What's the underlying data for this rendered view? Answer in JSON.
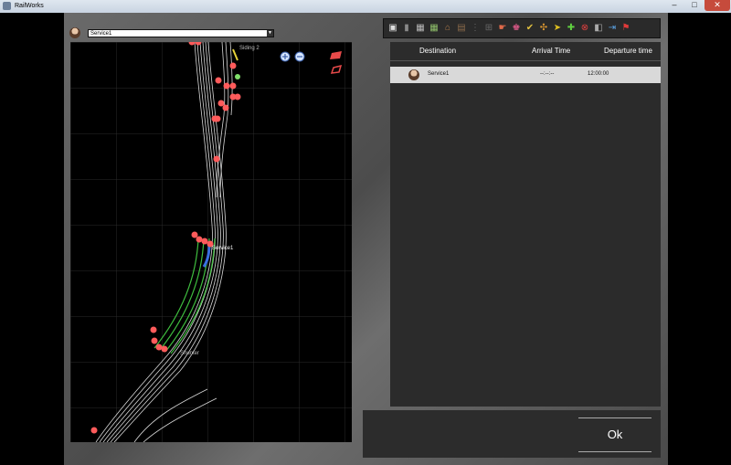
{
  "window": {
    "title": "RailWorks"
  },
  "map": {
    "service_selector_value": "Service1",
    "labels": [
      "Siding 2",
      "Service1",
      "Shunter"
    ]
  },
  "toolbar": {
    "icons": [
      "save-icon",
      "marker-icon",
      "grid-small-icon",
      "grid-large-icon",
      "house-icon",
      "crate-icon",
      "dashed-pair-icon",
      "dashed-box-icon",
      "pointer-hand-icon",
      "people-icon",
      "check-route-icon",
      "rearrange-icon",
      "arrow-plus-icon",
      "arrow-right-plus-icon",
      "delete-route-icon",
      "station-icon",
      "exit-icon",
      "flag-icon"
    ]
  },
  "table": {
    "columns": [
      "Destination",
      "Arrival Time",
      "Departure time"
    ],
    "rows": [
      {
        "destination": "Service1",
        "arrival": "--:--:--",
        "departure": "12:00:00"
      }
    ]
  },
  "footer": {
    "ok_label": "Ok"
  }
}
